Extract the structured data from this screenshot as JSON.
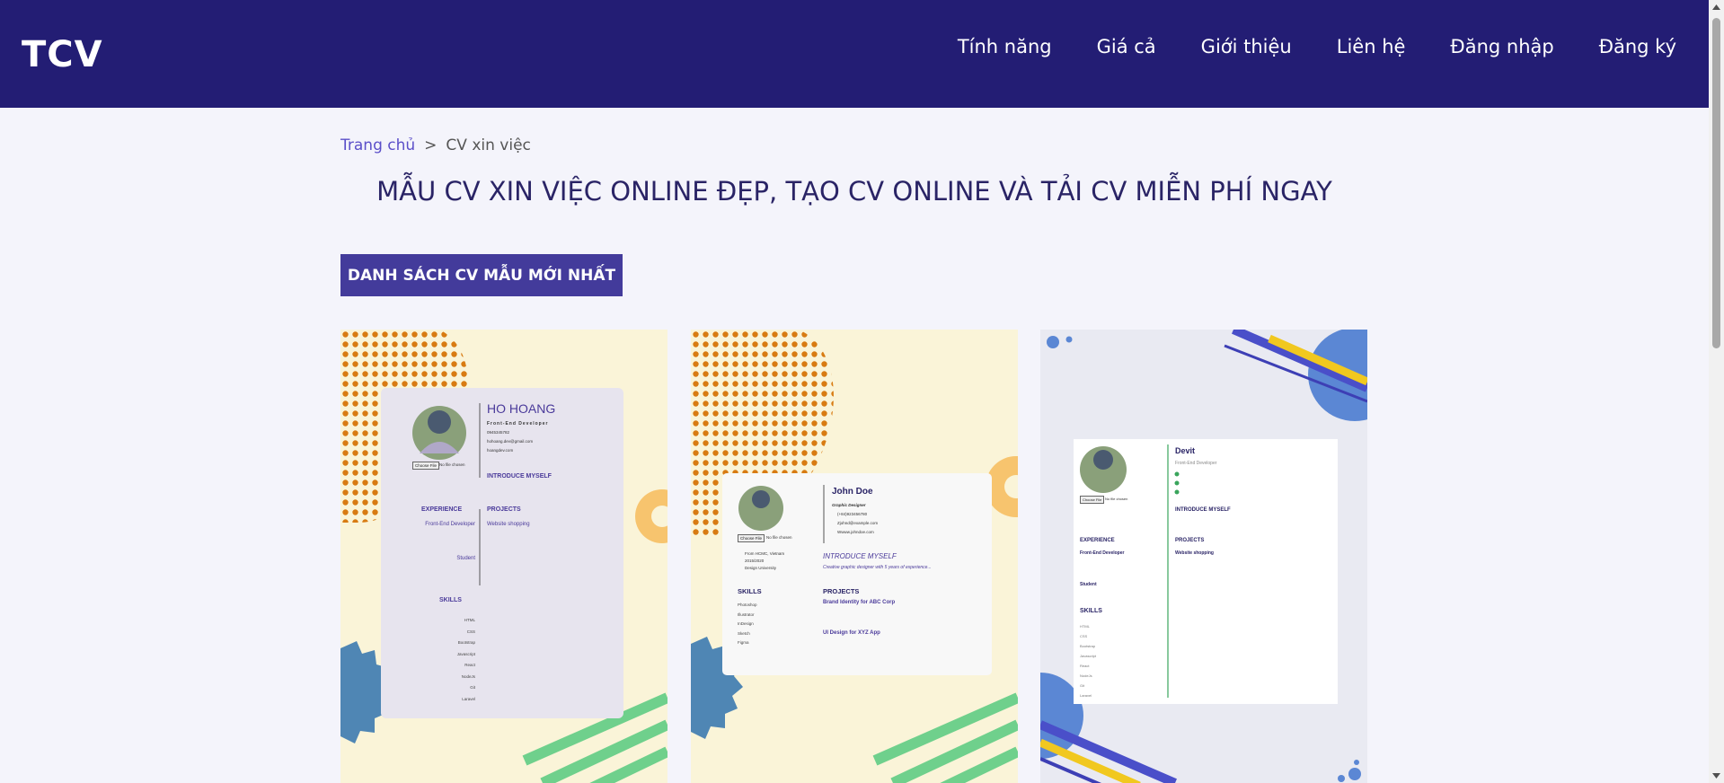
{
  "brand": {
    "logo": "TCV"
  },
  "nav": {
    "items": [
      "Tính năng",
      "Giá cả",
      "Giới thiệu",
      "Liên hệ",
      "Đăng nhập",
      "Đăng ký"
    ]
  },
  "breadcrumb": {
    "home": "Trang chủ",
    "separator": ">",
    "current": "CV xin việc"
  },
  "page": {
    "title": "MẪU CV XIN VIỆC ONLINE ĐẸP, TẠO CV ONLINE VÀ TẢI CV MIỄN PHÍ NGAY",
    "list_button": "DANH SÁCH CV MẪU MỚI NHẤT"
  },
  "templates": [
    {
      "name": "HO HOANG",
      "role": "Front-End Developer",
      "contacts": [
        "0945345782",
        "hohoang.dev@gmail.com",
        "hoangdev.com"
      ],
      "file_button": "Choose File",
      "file_text": "No file chosen",
      "intro_heading": "INTRODUCE MYSELF",
      "experience_heading": "EXPERIENCE",
      "experience_items": [
        "Front-End Developer",
        "Student"
      ],
      "projects_heading": "PROJECTS",
      "project": "Website shopping",
      "skills_heading": "SKILLS",
      "skills": [
        "HTML",
        "CSS",
        "Bootstrap",
        "Javascript",
        "React",
        "NodeJs",
        "Git",
        "Laravel"
      ]
    },
    {
      "name": "John Doe",
      "role": "Graphic Designer",
      "contacts": [
        "(+84)923456780",
        "Zjohnd@example.com",
        "Wwww.johndoe.com"
      ],
      "file_button": "Choose File",
      "file_text": "No file chosen",
      "education": [
        "From HCMC, Vietnam",
        "2015/2020",
        "Design University"
      ],
      "intro_heading": "INTRODUCE MYSELF",
      "intro_text": "Creative graphic designer with 5 years of experience...",
      "skills_heading": "SKILLS",
      "skills": [
        "Photoshop",
        "Illustrator",
        "InDesign",
        "Sketch",
        "Figma"
      ],
      "projects_heading": "PROJECTS",
      "projects": [
        "Brand Identity for ABC Corp",
        "UI Design for XYZ App"
      ]
    },
    {
      "name": "Devit",
      "role": "Front-End Developer",
      "file_button": "Choose File",
      "file_text": "No file chosen",
      "intro_heading": "INTRODUCE MYSELF",
      "experience_heading": "EXPERIENCE",
      "experience_items": [
        "Front-End Developer",
        "Student"
      ],
      "projects_heading": "PROJECTS",
      "project": "Website shopping",
      "skills_heading": "SKILLS",
      "skills": [
        "HTML",
        "CSS",
        "Bootstrap",
        "Javascript",
        "React",
        "NodeJs",
        "Git",
        "Laravel"
      ]
    }
  ],
  "colors": {
    "navbar": "#231d74",
    "accent": "#433b9b",
    "link": "#5b4fc9",
    "title": "#2a2466"
  }
}
